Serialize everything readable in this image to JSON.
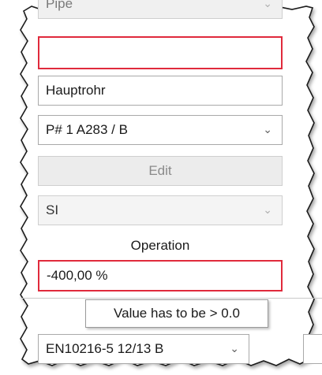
{
  "form": {
    "type_field": {
      "value": "Pipe",
      "icon": "chevron-down-icon"
    },
    "name_field": {
      "value": "",
      "state": "error",
      "border_color": "#e02a3c"
    },
    "description_field": {
      "value": "Hauptrohr"
    },
    "material_select": {
      "value": "P# 1 A283 / B",
      "icon": "chevron-down-icon"
    },
    "edit_button": {
      "label": "Edit"
    },
    "unit_select": {
      "value": "SI",
      "icon": "chevron-down-icon"
    },
    "operation_label": "Operation",
    "operation_field": {
      "value": "-400,00 %",
      "state": "error"
    },
    "validation_tooltip": "Value has to be > 0.0",
    "standard_select": {
      "value": "EN10216-5   12/13 B",
      "icon": "chevron-down-icon"
    }
  }
}
